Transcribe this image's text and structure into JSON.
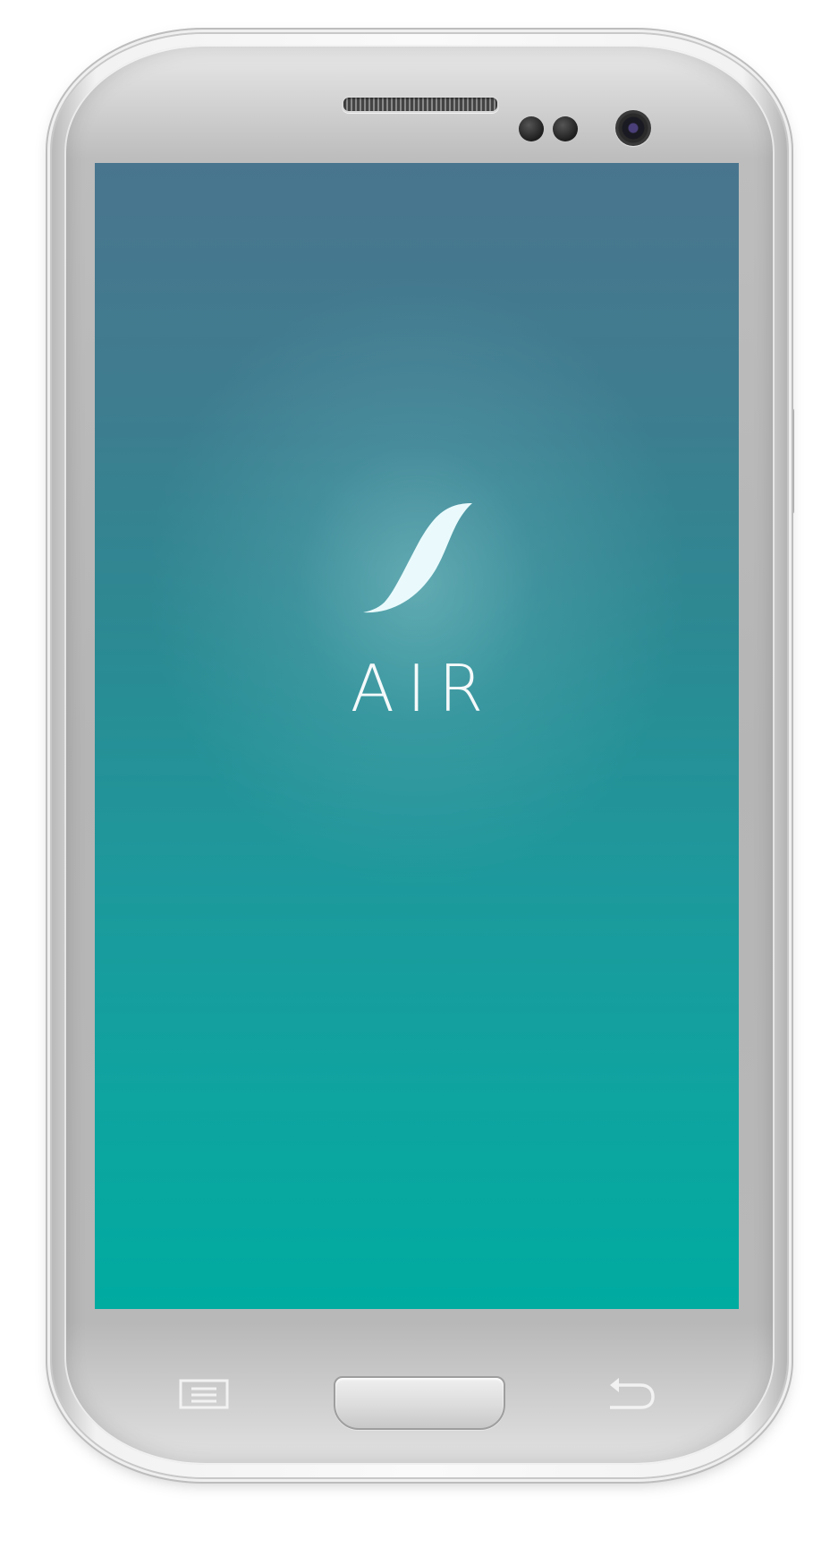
{
  "app": {
    "name": "AIR"
  },
  "device": {
    "nav_keys": [
      "menu-key",
      "home-key",
      "back-key"
    ]
  },
  "colors": {
    "screen_top": "#49758e",
    "screen_bottom": "#00aba0",
    "logo": "#eafafc",
    "text": "#ffffff"
  },
  "icons": {
    "logo": "leaf-icon",
    "menu": "menu-icon",
    "back": "back-arrow-icon"
  }
}
